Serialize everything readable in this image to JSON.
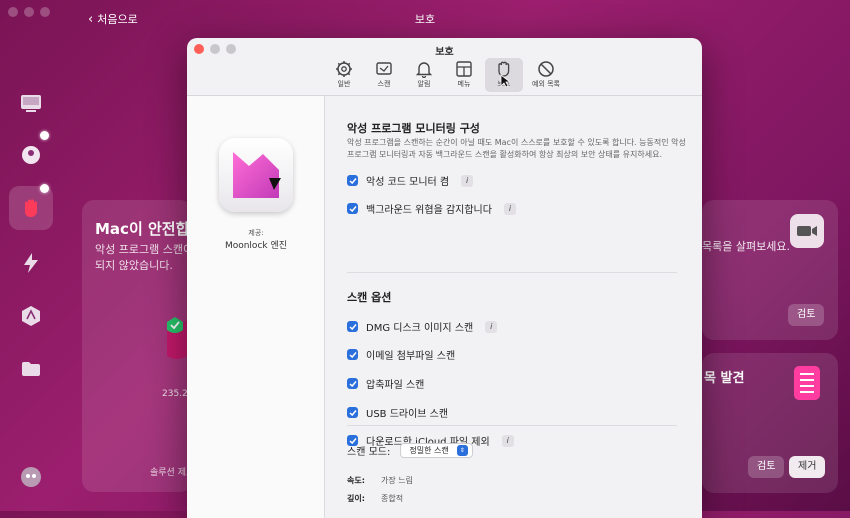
{
  "background": {
    "title": "보호",
    "back_label": "처음으로",
    "left_card": {
      "title": "Mac이 안전합니",
      "description": "악성 프로그램 스캔이\n되지 않았습니다.",
      "stat": "235.2",
      "footer": "솔루션 제고"
    },
    "right_top_card": {
      "description": "목록을 살펴보세요.",
      "button": "검토"
    },
    "right_bottom_card": {
      "title": "목 발견",
      "review_button": "검토",
      "remove_button": "제거"
    }
  },
  "window": {
    "title": "보호",
    "tabs": [
      {
        "label": "일반",
        "icon": "gear-icon"
      },
      {
        "label": "스캔",
        "icon": "scan-icon"
      },
      {
        "label": "알림",
        "icon": "bell-icon"
      },
      {
        "label": "메뉴",
        "icon": "menu-icon"
      },
      {
        "label": "보호",
        "icon": "hand-icon"
      },
      {
        "label": "예외 목록",
        "icon": "prohibited-icon"
      }
    ],
    "active_tab": "보호",
    "provider_label": "제공:",
    "provider_name": "Moonlock 엔진",
    "monitoring": {
      "title": "악성 프로그램 모니터링 구성",
      "description": "악성 프로그램을 스캔하는 순간이 아닐 때도 Mac이 스스로를 보호할 수 있도록 합니다. 능동적인 악성 프로그램 모니터링과 자동 백그라운드 스캔을 활성화하여 항상 최상의 보안 상태를 유지하세요.",
      "options": [
        {
          "label": "악성 코드 모니터 켬",
          "checked": true,
          "info": true
        },
        {
          "label": "백그라운드 위협을 감지합니다",
          "checked": true,
          "info": true
        }
      ]
    },
    "scan_options": {
      "title": "스캔 옵션",
      "options": [
        {
          "label": "DMG 디스크 이미지 스캔",
          "checked": true,
          "info": true
        },
        {
          "label": "이메일 첨부파일 스캔",
          "checked": true,
          "info": false
        },
        {
          "label": "압축파일 스캔",
          "checked": true,
          "info": false
        },
        {
          "label": "USB 드라이브 스캔",
          "checked": true,
          "info": false
        },
        {
          "label": "다운로드한 iCloud 파일 제외",
          "checked": true,
          "info": true
        }
      ]
    },
    "scan_mode": {
      "label": "스캔 모드:",
      "value": "정밀한 스캔",
      "speed_label": "속도:",
      "speed_value": "가장 느림",
      "depth_label": "깊이:",
      "depth_value": "종합적"
    },
    "info_glyph": "i"
  },
  "colors": {
    "accent": "#2a6fdb",
    "bg": "#8a1a63",
    "close": "#ff5f57"
  }
}
